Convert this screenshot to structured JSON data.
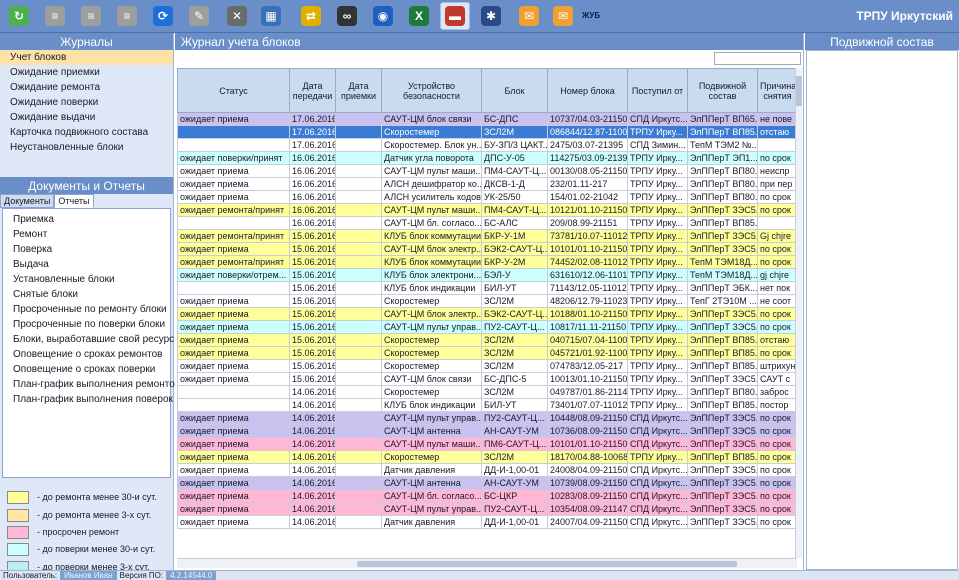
{
  "app_title": "ТРПУ Иркутский",
  "toolbar": {
    "label": "ЖУБ",
    "buttons": [
      {
        "icon": "refresh-icon",
        "color": "#4caf50"
      },
      {
        "icon": "database-icon",
        "color": "#9e9e9e"
      },
      {
        "icon": "database-export-icon",
        "color": "#9e9e9e"
      },
      {
        "icon": "database-settings-icon",
        "color": "#9e9e9e"
      },
      {
        "icon": "sync-icon",
        "color": "#1e6fd9"
      },
      {
        "icon": "tools-icon",
        "color": "#9e9e9e"
      },
      {
        "icon": "wrench-icon",
        "color": "#6b6b6b"
      },
      {
        "icon": "calculator-icon",
        "color": "#3b6fb6"
      },
      {
        "icon": "user-transfer-icon",
        "color": "#e0b000"
      },
      {
        "icon": "binoculars-icon",
        "color": "#333333"
      },
      {
        "icon": "globe-icon",
        "color": "#1f5fbf"
      },
      {
        "icon": "excel-icon",
        "color": "#1d7a3a"
      },
      {
        "icon": "train-icon",
        "color": "#c0392b"
      },
      {
        "icon": "bug-icon",
        "color": "#2b4a8a"
      },
      {
        "icon": "mail-icon",
        "color": "#f0a030"
      },
      {
        "icon": "mail-edit-icon",
        "color": "#f0a030"
      }
    ]
  },
  "journals": {
    "title": "Журналы",
    "items": [
      "Учет блоков",
      "Ожидание приемки",
      "Ожидание ремонта",
      "Ожидание поверки",
      "Ожидание выдачи",
      "Карточка подвижного состава",
      "Неустановленные блоки"
    ],
    "selected_index": 0
  },
  "documents": {
    "title": "Документы и Отчеты",
    "tabs": [
      "Документы",
      "Отчеты"
    ],
    "active_tab": 1,
    "reports": [
      "Приемка",
      "Ремонт",
      "Поверка",
      "Выдача",
      "Установленные блоки",
      "Снятые блоки",
      "Просроченные по ремонту блоки",
      "Просроченные по поверки блоки",
      "Блоки, выработавшие свой ресурс",
      "Оповещение о сроках ремонтов",
      "Оповещение о сроках поверки",
      "План-график выполнения ремонтов",
      "План-график выполнения поверок"
    ]
  },
  "legend": [
    {
      "color": "#ffff99",
      "label": "- до ремонта менее 30-и сут."
    },
    {
      "color": "#ffe7a8",
      "label": "- до ремонта менее 3-х сут."
    },
    {
      "color": "#ffb7d5",
      "label": "- просрочен ремонт"
    },
    {
      "color": "#ccffff",
      "label": "- до поверки менее 30-и сут."
    },
    {
      "color": "#b9f0f2",
      "label": "- до поверки менее 3-х сут."
    },
    {
      "color": "#c9c2f0",
      "label": "- просрочена поверка"
    }
  ],
  "journal": {
    "title": "Журнал учета блоков",
    "columns": [
      "Статус",
      "Дата передачи",
      "Дата приемки",
      "Устройство безопасности",
      "Блок",
      "Номер блока",
      "Поступил от",
      "Подвижной состав",
      "Причина снятия"
    ],
    "rows": [
      {
        "status": "ожидает приема",
        "date_tx": "17.06.2016",
        "date_rx": "",
        "device": "САУТ-ЦМ блок связи",
        "block": "БС-ДПС",
        "number": "10737/04.03-21150",
        "from": "СПД Иркутс...",
        "stock": "ЭлППерТ ВП65...",
        "reason": "не пове",
        "color": "#c9c2f0"
      },
      {
        "status": "",
        "date_tx": "17.06.2016",
        "date_rx": "",
        "device": "Скоростемер",
        "block": "ЗСЛ2М",
        "number": "086844/12.87-11006",
        "from": "ТРПУ Ирку...",
        "stock": "ЭлППерТ ВП85...",
        "reason": "отстаю",
        "color": "#3a7bd5",
        "selected": true
      },
      {
        "status": "",
        "date_tx": "17.06.2016",
        "date_rx": "",
        "device": "Скоростемер. Блок ун...",
        "block": "БУ-ЗП/3 ЦАКТ...",
        "number": "2475/03.07-21395",
        "from": "СПД Зимин...",
        "stock": "ТепМ ТЭМ2 №...",
        "reason": "",
        "color": "#ffffff"
      },
      {
        "status": "ожидает поверки/принят",
        "date_tx": "16.06.2016",
        "date_rx": "",
        "device": "Датчик угла поворота",
        "block": "ДПС-У-05",
        "number": "114275/03.09-21395",
        "from": "ТРПУ Ирку...",
        "stock": "ЭлППерТ ЭП1...",
        "reason": "по срок",
        "color": "#ccffff"
      },
      {
        "status": "ожидает приема",
        "date_tx": "16.06.2016",
        "date_rx": "",
        "device": "САУТ-ЦМ пульт маши...",
        "block": "ПМ4-САУТ-Ц...",
        "number": "00130/08.05-21150",
        "from": "ТРПУ Ирку...",
        "stock": "ЭлППерТ ВП80...",
        "reason": "неиспр",
        "color": "#ffffff"
      },
      {
        "status": "ожидает приема",
        "date_tx": "16.06.2016",
        "date_rx": "",
        "device": "АЛСН дешифратор ко...",
        "block": "ДКСВ-1-Д",
        "number": "232/01.11-217",
        "from": "ТРПУ Ирку...",
        "stock": "ЭлППерТ ВП80...",
        "reason": "при пер",
        "color": "#ffffff"
      },
      {
        "status": "ожидает приема",
        "date_tx": "16.06.2016",
        "date_rx": "",
        "device": "АЛСН усилитель кодов",
        "block": "УК-25/50",
        "number": "154/01.02-21042",
        "from": "ТРПУ Ирку...",
        "stock": "ЭлППерТ ВП80...",
        "reason": "по срок",
        "color": "#ffffff"
      },
      {
        "status": "ожидает ремонта/принят",
        "date_tx": "16.06.2016",
        "date_rx": "",
        "device": "САУТ-ЦМ пульт маши...",
        "block": "ПМ4-САУТ-Ц...",
        "number": "10121/01.10-21150",
        "from": "ТРПУ Ирку...",
        "stock": "ЭлППерТ ЗЭС5...",
        "reason": "по срок",
        "color": "#ffff99"
      },
      {
        "status": "",
        "date_tx": "16.06.2016",
        "date_rx": "",
        "device": "САУТ-ЦМ бл. согласо...",
        "block": "БС-АЛС",
        "number": "209/08.99-21151",
        "from": "ТРПУ Ирку...",
        "stock": "ЭлППерТ ВП85...",
        "reason": "",
        "color": "#ffffff"
      },
      {
        "status": "ожидает ремонта/принят",
        "date_tx": "15.06.2016",
        "date_rx": "",
        "device": "КЛУБ блок коммутации",
        "block": "БКР-У-1М",
        "number": "73781/10.07-11012",
        "from": "ТРПУ Ирку...",
        "stock": "ЭлППерТ ЗЭС5...",
        "reason": "Gj chjre",
        "color": "#ffff99"
      },
      {
        "status": "ожидает приема",
        "date_tx": "15.06.2016",
        "date_rx": "",
        "device": "САУТ-ЦМ блок электр...",
        "block": "БЭК2-САУТ-Ц...",
        "number": "10101/01.10-21150",
        "from": "ТРПУ Ирку...",
        "stock": "ЭлППерТ ЗЭС5...",
        "reason": "по срок",
        "color": "#ffff99"
      },
      {
        "status": "ожидает ремонта/принят",
        "date_tx": "15.06.2016",
        "date_rx": "",
        "device": "КЛУБ блок коммутации",
        "block": "БКР-У-2М",
        "number": "74452/02.08-11012",
        "from": "ТРПУ Ирку...",
        "stock": "ТепМ ТЭМ18Д...",
        "reason": "по срок",
        "color": "#ffff99"
      },
      {
        "status": "ожидает поверки/отрем...",
        "date_tx": "15.06.2016",
        "date_rx": "",
        "device": "КЛУБ блок электрони...",
        "block": "БЭЛ-У",
        "number": "631610/12.06-11012",
        "from": "ТРПУ Ирку...",
        "stock": "ТепМ ТЭМ18Д...",
        "reason": "gj chjre",
        "color": "#ccffff"
      },
      {
        "status": "",
        "date_tx": "15.06.2016",
        "date_rx": "",
        "device": "КЛУБ блок индикации",
        "block": "БИЛ-УТ",
        "number": "71143/12.05-11012",
        "from": "ТРПУ Ирку...",
        "stock": "ЭлППерТ ЭБК...",
        "reason": "нет пок",
        "color": "#ffffff"
      },
      {
        "status": "ожидает приема",
        "date_tx": "15.06.2016",
        "date_rx": "",
        "device": "Скоростемер",
        "block": "ЗСЛ2М",
        "number": "48206/12.79-11023",
        "from": "ТРПУ Ирку...",
        "stock": "ТепГ 2ТЭ10М ...",
        "reason": "не соот",
        "color": "#ffffff"
      },
      {
        "status": "ожидает приема",
        "date_tx": "15.06.2016",
        "date_rx": "",
        "device": "САУТ-ЦМ блок электр...",
        "block": "БЭК2-САУТ-Ц...",
        "number": "10188/01.10-21150",
        "from": "ТРПУ Ирку...",
        "stock": "ЭлППерТ ЗЭС5...",
        "reason": "по срок",
        "color": "#ffff99"
      },
      {
        "status": "ожидает приема",
        "date_tx": "15.06.2016",
        "date_rx": "",
        "device": "САУТ-ЦМ пульт управ...",
        "block": "ПУ2-САУТ-Ц...",
        "number": "10817/11.11-21150",
        "from": "ТРПУ Ирку...",
        "stock": "ЭлППерТ ЗЭС5...",
        "reason": "по срок",
        "color": "#ccffff"
      },
      {
        "status": "ожидает приема",
        "date_tx": "15.06.2016",
        "date_rx": "",
        "device": "Скоростемер",
        "block": "ЗСЛ2М",
        "number": "040715/07.04-11006",
        "from": "ТРПУ Ирку...",
        "stock": "ЭлППерТ ВП85...",
        "reason": "отстаю",
        "color": "#ffff99"
      },
      {
        "status": "ожидает приема",
        "date_tx": "15.06.2016",
        "date_rx": "",
        "device": "Скоростемер",
        "block": "ЗСЛ2М",
        "number": "045721/01.92-11006",
        "from": "ТРПУ Ирку...",
        "stock": "ЭлППерТ ВП85...",
        "reason": "по срок",
        "color": "#ffff99"
      },
      {
        "status": "ожидает приема",
        "date_tx": "15.06.2016",
        "date_rx": "",
        "device": "Скоростемер",
        "block": "ЗСЛ2М",
        "number": "074783/12.05-217",
        "from": "ТРПУ Ирку...",
        "stock": "ЭлППерТ ВП85...",
        "reason": "штрихун",
        "color": "#ffffff"
      },
      {
        "status": "ожидает приема",
        "date_tx": "15.06.2016",
        "date_rx": "",
        "device": "САУТ-ЦМ блок связи",
        "block": "БС-ДПС-5",
        "number": "10013/01.10-21150",
        "from": "ТРПУ Ирку...",
        "stock": "ЭлППерТ ЗЭС5...",
        "reason": "САУТ с",
        "color": "#ffffff"
      },
      {
        "status": "",
        "date_tx": "14.06.2016",
        "date_rx": "",
        "device": "Скоростемер",
        "block": "ЗСЛ2М",
        "number": "049787/01.86-21145",
        "from": "ТРПУ Ирку...",
        "stock": "ЭлППерТ ВП80...",
        "reason": "заброс",
        "color": "#ffffff"
      },
      {
        "status": "",
        "date_tx": "14.06.2016",
        "date_rx": "",
        "device": "КЛУБ блок индикации",
        "block": "БИЛ-УТ",
        "number": "73401/07.07-11012",
        "from": "ТРПУ Ирку...",
        "stock": "ЭлППерТ ВП85...",
        "reason": "постор",
        "color": "#ffffff"
      },
      {
        "status": "ожидает приема",
        "date_tx": "14.06.2016",
        "date_rx": "",
        "device": "САУТ-ЦМ пульт управ...",
        "block": "ПУ2-САУТ-Ц...",
        "number": "10448/08.09-21150",
        "from": "СПД Иркутс...",
        "stock": "ЭлППерТ ЗЭС5...",
        "reason": "по срок",
        "color": "#c9c2f0"
      },
      {
        "status": "ожидает приема",
        "date_tx": "14.06.2016",
        "date_rx": "",
        "device": "САУТ-ЦМ антенна",
        "block": "АН-САУТ-УМ",
        "number": "10736/08.09-21150",
        "from": "СПД Иркутс...",
        "stock": "ЭлППерТ ЗЭС5...",
        "reason": "по срок",
        "color": "#c9c2f0"
      },
      {
        "status": "ожидает приема",
        "date_tx": "14.06.2016",
        "date_rx": "",
        "device": "САУТ-ЦМ пульт маши...",
        "block": "ПМ6-САУТ-Ц...",
        "number": "10101/01.10-21150",
        "from": "СПД Иркутс...",
        "stock": "ЭлППерТ ЗЭС5...",
        "reason": "по срок",
        "color": "#ffb7d5"
      },
      {
        "status": "ожидает приема",
        "date_tx": "14.06.2016",
        "date_rx": "",
        "device": "Скоростемер",
        "block": "ЗСЛ2М",
        "number": "18170/04.88-10068",
        "from": "ТРПУ Ирку...",
        "stock": "ЭлППерТ ВП85...",
        "reason": "по срок",
        "color": "#ffff99"
      },
      {
        "status": "ожидает приема",
        "date_tx": "14.06.2016",
        "date_rx": "",
        "device": "Датчик давления",
        "block": "ДД-И-1,00-01",
        "number": "24008/04.09-21150",
        "from": "СПД Иркутс...",
        "stock": "ЭлППерТ ЗЭС5...",
        "reason": "по срок",
        "color": "#ffffff"
      },
      {
        "status": "ожидает приема",
        "date_tx": "14.06.2016",
        "date_rx": "",
        "device": "САУТ-ЦМ антенна",
        "block": "АН-САУТ-УМ",
        "number": "10739/08.09-21150",
        "from": "СПД Иркутс...",
        "stock": "ЭлППерТ ЗЭС5...",
        "reason": "по срок",
        "color": "#c9c2f0"
      },
      {
        "status": "ожидает приема",
        "date_tx": "14.06.2016",
        "date_rx": "",
        "device": "САУТ-ЦМ бл. согласо...",
        "block": "БС-ЦКР",
        "number": "10283/08.09-21150",
        "from": "СПД Иркутс...",
        "stock": "ЭлППерТ ЗЭС5...",
        "reason": "по срок",
        "color": "#ffb7d5"
      },
      {
        "status": "ожидает приема",
        "date_tx": "14.06.2016",
        "date_rx": "",
        "device": "САУТ-ЦМ пульт управ...",
        "block": "ПУ2-САУТ-Ц...",
        "number": "10354/08.09-21147",
        "from": "СПД Иркутс...",
        "stock": "ЭлППерТ ЗЭС5...",
        "reason": "по срок",
        "color": "#ffb7d5"
      },
      {
        "status": "ожидает приема",
        "date_tx": "14.06.2016",
        "date_rx": "",
        "device": "Датчик давления",
        "block": "ДД-И-1,00-01",
        "number": "24007/04.09-21150",
        "from": "СПД Иркутс...",
        "stock": "ЭлППерТ ЗЭС5...",
        "reason": "по срок",
        "color": "#ffffff"
      }
    ]
  },
  "rolling_stock": {
    "title": "Подвижной состав"
  },
  "status_bar": {
    "user_label": "Пользователь:",
    "user_value": "Иванов Иван",
    "version_label": "Версия ПО:",
    "version_value": "4.2.14544.0"
  }
}
